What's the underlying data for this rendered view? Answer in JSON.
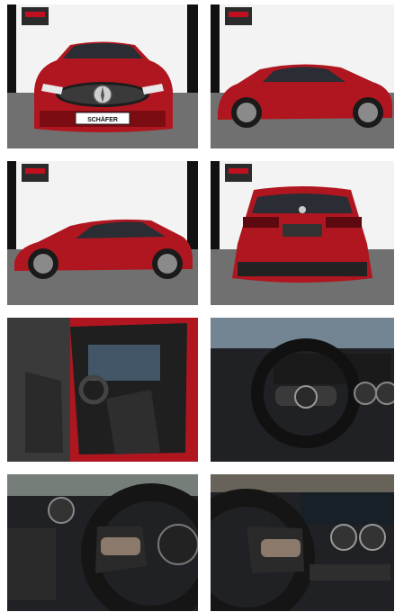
{
  "gallery": {
    "dealer_plate_text": "SCHÄFER",
    "colors": {
      "car_red": "#b0161f",
      "car_red_dark": "#6e0a10",
      "studio_wall": "#f2f2f2",
      "studio_floor": "#6f6f6f",
      "interior_dark": "#2a2a2a"
    },
    "photos": [
      {
        "view": "front"
      },
      {
        "view": "side-rear-three-quarter"
      },
      {
        "view": "side-profile"
      },
      {
        "view": "rear"
      },
      {
        "view": "driver-door-interior"
      },
      {
        "view": "steering-wheel-dashboard"
      },
      {
        "view": "steering-wheel-left-closeup"
      },
      {
        "view": "steering-wheel-right-closeup"
      }
    ]
  }
}
